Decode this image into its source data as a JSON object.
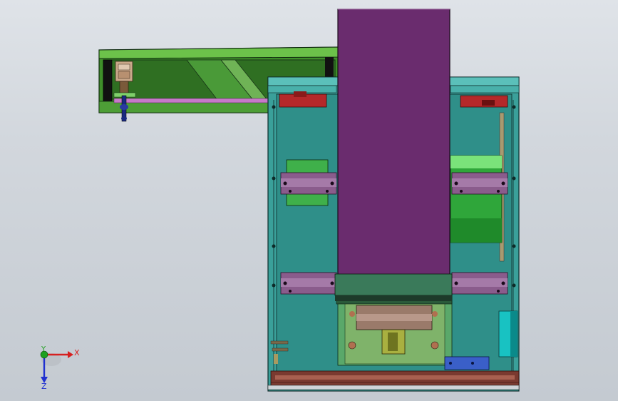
{
  "viewport": {
    "background_colors": [
      "#dfe3e8",
      "#c4cad1"
    ],
    "render_style": "shaded-with-edges",
    "view": "top",
    "units_visible": false
  },
  "model": {
    "parts": [
      {
        "id": "arm-beam",
        "color": "#5fa83a",
        "description_icon": "conveyor-arm"
      },
      {
        "id": "column-housing",
        "color": "#6a2c6e",
        "description_icon": "tall-housing"
      },
      {
        "id": "base-frame",
        "color": "#2e8a84",
        "description_icon": "frame-enclosure"
      },
      {
        "id": "clamp-blocks",
        "color": "#8a5c8c",
        "description_icon": "clamp"
      },
      {
        "id": "motor-cylinder",
        "color": "#2fa63a",
        "description_icon": "cylinder"
      },
      {
        "id": "red-brackets",
        "color": "#b5282a",
        "description_icon": "bracket"
      },
      {
        "id": "blue-plate",
        "color": "#3a5fc8",
        "description_icon": "plate"
      },
      {
        "id": "cyan-roller",
        "color": "#18c2c2",
        "description_icon": "roller"
      }
    ]
  },
  "triad": {
    "x_label": "X",
    "y_label": "Y",
    "z_label": "Z",
    "x_color": "#d62020",
    "y_color": "#1ea01e",
    "z_color": "#2030d0"
  }
}
